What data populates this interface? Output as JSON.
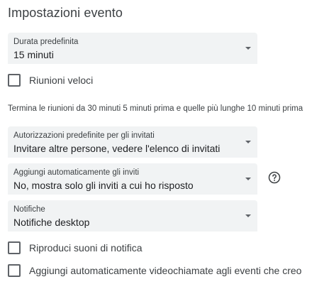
{
  "page_title": "Impostazioni evento",
  "default_duration": {
    "label": "Durata predefinita",
    "value": "15 minuti"
  },
  "speedy_meetings": {
    "label": "Riunioni veloci",
    "checked": false
  },
  "speedy_meetings_hint": "Termina le riunioni da 30 minuti 5 minuti prima e quelle più lunghe 10 minuti prima",
  "guest_permissions": {
    "label": "Autorizzazioni predefinite per gli invitati",
    "value": "Invitare altre persone, vedere l'elenco di invitati"
  },
  "auto_add_invitations": {
    "label": "Aggiungi automaticamente gli inviti",
    "value": "No, mostra solo gli inviti a cui ho risposto"
  },
  "notifications": {
    "label": "Notifiche",
    "value": "Notifiche desktop"
  },
  "play_sounds": {
    "label": "Riproduci suoni di notifica",
    "checked": false
  },
  "auto_add_video": {
    "label": "Aggiungi automaticamente videochiamate agli eventi che creo",
    "checked": false
  },
  "icons": {
    "dropdown": "dropdown-arrow-icon",
    "help": "help-circle-icon"
  }
}
